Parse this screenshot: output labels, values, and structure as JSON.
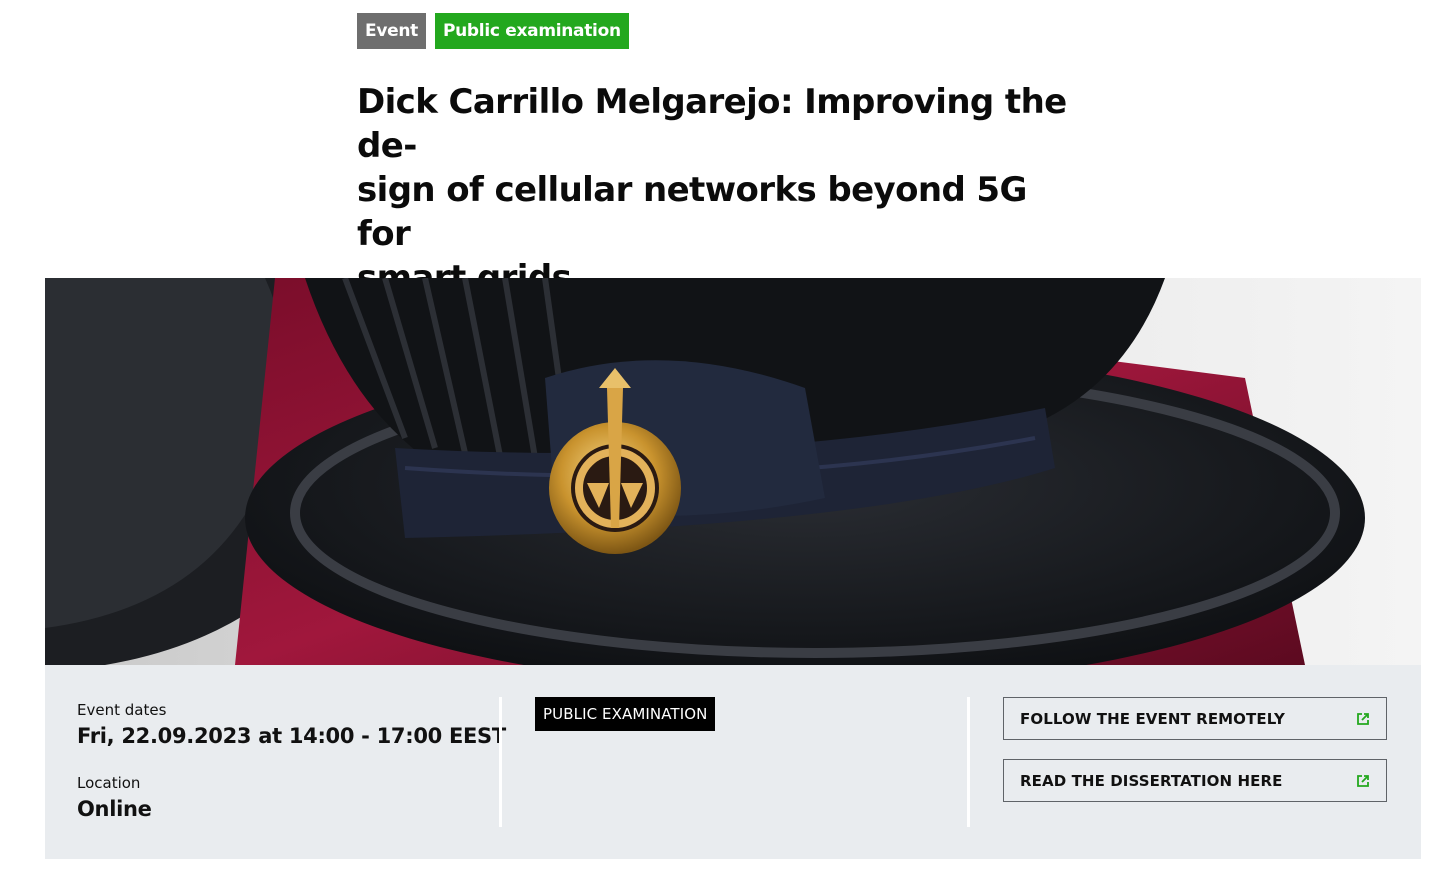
{
  "tags": {
    "event": "Event",
    "public": "Public examination"
  },
  "title": "Dick Carrillo Melgarejo: Improving the de- sign of cellular networks beyond 5G for smart grids",
  "title_lines": [
    "Dick Carrillo Melgarejo: Improving the de-",
    "sign of cellular networks beyond 5G for",
    "smart grids"
  ],
  "info": {
    "dates_label": "Event dates",
    "dates_value": "Fri, 22.09.2023 at 14:00 - 17:00 EEST",
    "location_label": "Location",
    "location_value": "Online",
    "type_badge": "PUBLIC EXAMINATION",
    "links": [
      {
        "label": "FOLLOW THE EVENT REMOTELY",
        "icon": "external-link-icon"
      },
      {
        "label": "READ THE DISSERTATION HERE",
        "icon": "external-link-icon"
      }
    ]
  },
  "colors": {
    "tag_event": "#6e6e6e",
    "tag_public": "#23a81e",
    "info_bg": "#e9ecef",
    "icon_green": "#23a81e"
  }
}
